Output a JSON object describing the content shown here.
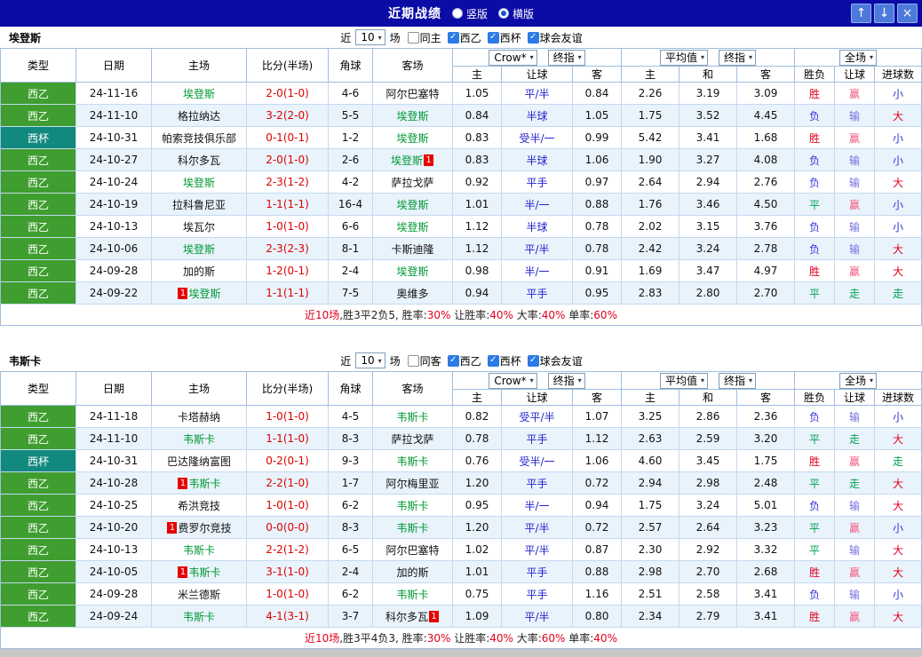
{
  "colors": {
    "red": "#e2001e",
    "blue": "#3434d6",
    "green": "#00a050",
    "pink": "#f2587e",
    "lilac": "#7070e0",
    "summary_black": "#222222"
  },
  "titlebar": {
    "title": "近期战绩",
    "layout_options": [
      {
        "label": "竖版",
        "selected": false
      },
      {
        "label": "横版",
        "selected": true
      }
    ],
    "buttons": {
      "up": "↑",
      "down": "↓",
      "close": "×"
    }
  },
  "filter_labels": {
    "near": "近",
    "count": "10",
    "games": "场"
  },
  "table_header": {
    "static_cols": [
      "类型",
      "日期",
      "主场",
      "比分(半场)",
      "角球",
      "客场"
    ],
    "group1": {
      "select1": "Crow*",
      "select2": "终指",
      "subcols": [
        "主",
        "让球",
        "客"
      ]
    },
    "group2": {
      "select1": "平均值",
      "select2": "终指",
      "subcols": [
        "主",
        "和",
        "客"
      ]
    },
    "group3": {
      "select1": "全场",
      "subcols": [
        "胜负",
        "让球",
        "进球数"
      ]
    }
  },
  "sections": [
    {
      "team": "埃登斯",
      "venue_filter": {
        "label": "同主",
        "checked": false
      },
      "league_filters": [
        {
          "label": "西乙",
          "checked": true
        },
        {
          "label": "西杯",
          "checked": true
        },
        {
          "label": "球会友谊",
          "checked": true
        }
      ],
      "rows": [
        {
          "league": "西乙",
          "style": "green",
          "date": "24-11-16",
          "home": {
            "name": "埃登斯",
            "focus": true
          },
          "score": "2-0(1-0)",
          "corner": "4-6",
          "away": {
            "name": "阿尔巴塞特",
            "focus": false
          },
          "asian": [
            "1.05",
            "平/半",
            "0.84"
          ],
          "euro": [
            "2.26",
            "3.19",
            "3.09"
          ],
          "results": [
            {
              "t": "胜",
              "c": "red"
            },
            {
              "t": "赢",
              "c": "pink"
            },
            {
              "t": "小",
              "c": "blue"
            }
          ]
        },
        {
          "league": "西乙",
          "style": "green",
          "date": "24-11-10",
          "home": {
            "name": "格拉纳达",
            "focus": false
          },
          "score": "3-2(2-0)",
          "corner": "5-5",
          "away": {
            "name": "埃登斯",
            "focus": true
          },
          "asian": [
            "0.84",
            "半球",
            "1.05"
          ],
          "euro": [
            "1.75",
            "3.52",
            "4.45"
          ],
          "results": [
            {
              "t": "负",
              "c": "blue"
            },
            {
              "t": "输",
              "c": "lilac"
            },
            {
              "t": "大",
              "c": "red"
            }
          ]
        },
        {
          "league": "西杯",
          "style": "teal",
          "date": "24-10-31",
          "home": {
            "name": "帕索竞技俱乐部",
            "focus": false
          },
          "score": "0-1(0-1)",
          "corner": "1-2",
          "away": {
            "name": "埃登斯",
            "focus": true
          },
          "asian": [
            "0.83",
            "受半/一",
            "0.99"
          ],
          "euro": [
            "5.42",
            "3.41",
            "1.68"
          ],
          "results": [
            {
              "t": "胜",
              "c": "red"
            },
            {
              "t": "赢",
              "c": "pink"
            },
            {
              "t": "小",
              "c": "blue"
            }
          ]
        },
        {
          "league": "西乙",
          "style": "green",
          "date": "24-10-27",
          "home": {
            "name": "科尔多瓦",
            "focus": false
          },
          "score": "2-0(1-0)",
          "corner": "2-6",
          "away": {
            "name": "埃登斯",
            "focus": true,
            "badge": "1",
            "badge_pos": "after"
          },
          "asian": [
            "0.83",
            "半球",
            "1.06"
          ],
          "euro": [
            "1.90",
            "3.27",
            "4.08"
          ],
          "results": [
            {
              "t": "负",
              "c": "blue"
            },
            {
              "t": "输",
              "c": "lilac"
            },
            {
              "t": "小",
              "c": "blue"
            }
          ]
        },
        {
          "league": "西乙",
          "style": "green",
          "date": "24-10-24",
          "home": {
            "name": "埃登斯",
            "focus": true
          },
          "score": "2-3(1-2)",
          "corner": "4-2",
          "away": {
            "name": "萨拉戈萨",
            "focus": false
          },
          "asian": [
            "0.92",
            "平手",
            "0.97"
          ],
          "euro": [
            "2.64",
            "2.94",
            "2.76"
          ],
          "results": [
            {
              "t": "负",
              "c": "blue"
            },
            {
              "t": "输",
              "c": "lilac"
            },
            {
              "t": "大",
              "c": "red"
            }
          ]
        },
        {
          "league": "西乙",
          "style": "green",
          "date": "24-10-19",
          "home": {
            "name": "拉科鲁尼亚",
            "focus": false
          },
          "score": "1-1(1-1)",
          "corner": "16-4",
          "away": {
            "name": "埃登斯",
            "focus": true
          },
          "asian": [
            "1.01",
            "半/一",
            "0.88"
          ],
          "euro": [
            "1.76",
            "3.46",
            "4.50"
          ],
          "results": [
            {
              "t": "平",
              "c": "green"
            },
            {
              "t": "赢",
              "c": "pink"
            },
            {
              "t": "小",
              "c": "blue"
            }
          ]
        },
        {
          "league": "西乙",
          "style": "green",
          "date": "24-10-13",
          "home": {
            "name": "埃瓦尔",
            "focus": false
          },
          "score": "1-0(1-0)",
          "corner": "6-6",
          "away": {
            "name": "埃登斯",
            "focus": true
          },
          "asian": [
            "1.12",
            "半球",
            "0.78"
          ],
          "euro": [
            "2.02",
            "3.15",
            "3.76"
          ],
          "results": [
            {
              "t": "负",
              "c": "blue"
            },
            {
              "t": "输",
              "c": "lilac"
            },
            {
              "t": "小",
              "c": "blue"
            }
          ]
        },
        {
          "league": "西乙",
          "style": "green",
          "date": "24-10-06",
          "home": {
            "name": "埃登斯",
            "focus": true
          },
          "score": "2-3(2-3)",
          "corner": "8-1",
          "away": {
            "name": "卡斯迪隆",
            "focus": false
          },
          "asian": [
            "1.12",
            "平/半",
            "0.78"
          ],
          "euro": [
            "2.42",
            "3.24",
            "2.78"
          ],
          "results": [
            {
              "t": "负",
              "c": "blue"
            },
            {
              "t": "输",
              "c": "lilac"
            },
            {
              "t": "大",
              "c": "red"
            }
          ]
        },
        {
          "league": "西乙",
          "style": "green",
          "date": "24-09-28",
          "home": {
            "name": "加的斯",
            "focus": false
          },
          "score": "1-2(0-1)",
          "corner": "2-4",
          "away": {
            "name": "埃登斯",
            "focus": true
          },
          "asian": [
            "0.98",
            "半/一",
            "0.91"
          ],
          "euro": [
            "1.69",
            "3.47",
            "4.97"
          ],
          "results": [
            {
              "t": "胜",
              "c": "red"
            },
            {
              "t": "赢",
              "c": "pink"
            },
            {
              "t": "大",
              "c": "red"
            }
          ]
        },
        {
          "league": "西乙",
          "style": "green",
          "date": "24-09-22",
          "home": {
            "name": "埃登斯",
            "focus": true,
            "badge": "1",
            "badge_pos": "before"
          },
          "score": "1-1(1-1)",
          "corner": "7-5",
          "away": {
            "name": "奥维多",
            "focus": false
          },
          "asian": [
            "0.94",
            "平手",
            "0.95"
          ],
          "euro": [
            "2.83",
            "2.80",
            "2.70"
          ],
          "results": [
            {
              "t": "平",
              "c": "green"
            },
            {
              "t": "走",
              "c": "green"
            },
            {
              "t": "走",
              "c": "green"
            }
          ]
        }
      ],
      "summary": [
        {
          "t": "近10场",
          "c": "red"
        },
        {
          "t": ",胜3平2负5, ",
          "c": "black"
        },
        {
          "t": "胜率:",
          "c": "black"
        },
        {
          "t": "30%",
          "c": "red"
        },
        {
          "t": " 让胜率:",
          "c": "black"
        },
        {
          "t": "40%",
          "c": "red"
        },
        {
          "t": " 大率:",
          "c": "black"
        },
        {
          "t": "40%",
          "c": "red"
        },
        {
          "t": " 单率:",
          "c": "black"
        },
        {
          "t": "60%",
          "c": "red"
        }
      ]
    },
    {
      "team": "韦斯卡",
      "venue_filter": {
        "label": "同客",
        "checked": false
      },
      "league_filters": [
        {
          "label": "西乙",
          "checked": true
        },
        {
          "label": "西杯",
          "checked": true
        },
        {
          "label": "球会友谊",
          "checked": true
        }
      ],
      "rows": [
        {
          "league": "西乙",
          "style": "green",
          "date": "24-11-18",
          "home": {
            "name": "卡塔赫纳",
            "focus": false
          },
          "score": "1-0(1-0)",
          "corner": "4-5",
          "away": {
            "name": "韦斯卡",
            "focus": true
          },
          "asian": [
            "0.82",
            "受平/半",
            "1.07"
          ],
          "euro": [
            "3.25",
            "2.86",
            "2.36"
          ],
          "results": [
            {
              "t": "负",
              "c": "blue"
            },
            {
              "t": "输",
              "c": "lilac"
            },
            {
              "t": "小",
              "c": "blue"
            }
          ]
        },
        {
          "league": "西乙",
          "style": "green",
          "date": "24-11-10",
          "home": {
            "name": "韦斯卡",
            "focus": true
          },
          "score": "1-1(1-0)",
          "corner": "8-3",
          "away": {
            "name": "萨拉戈萨",
            "focus": false
          },
          "asian": [
            "0.78",
            "平手",
            "1.12"
          ],
          "euro": [
            "2.63",
            "2.59",
            "3.20"
          ],
          "results": [
            {
              "t": "平",
              "c": "green"
            },
            {
              "t": "走",
              "c": "green"
            },
            {
              "t": "大",
              "c": "red"
            }
          ]
        },
        {
          "league": "西杯",
          "style": "teal",
          "date": "24-10-31",
          "home": {
            "name": "巴达隆纳富图",
            "focus": false
          },
          "score": "0-2(0-1)",
          "corner": "9-3",
          "away": {
            "name": "韦斯卡",
            "focus": true
          },
          "asian": [
            "0.76",
            "受半/一",
            "1.06"
          ],
          "euro": [
            "4.60",
            "3.45",
            "1.75"
          ],
          "results": [
            {
              "t": "胜",
              "c": "red"
            },
            {
              "t": "赢",
              "c": "pink"
            },
            {
              "t": "走",
              "c": "green"
            }
          ]
        },
        {
          "league": "西乙",
          "style": "green",
          "date": "24-10-28",
          "home": {
            "name": "韦斯卡",
            "focus": true,
            "badge": "1",
            "badge_pos": "before"
          },
          "score": "2-2(1-0)",
          "corner": "1-7",
          "away": {
            "name": "阿尔梅里亚",
            "focus": false
          },
          "asian": [
            "1.20",
            "平手",
            "0.72"
          ],
          "euro": [
            "2.94",
            "2.98",
            "2.48"
          ],
          "results": [
            {
              "t": "平",
              "c": "green"
            },
            {
              "t": "走",
              "c": "green"
            },
            {
              "t": "大",
              "c": "red"
            }
          ]
        },
        {
          "league": "西乙",
          "style": "green",
          "date": "24-10-25",
          "home": {
            "name": "希洪竞技",
            "focus": false
          },
          "score": "1-0(1-0)",
          "corner": "6-2",
          "away": {
            "name": "韦斯卡",
            "focus": true
          },
          "asian": [
            "0.95",
            "半/一",
            "0.94"
          ],
          "euro": [
            "1.75",
            "3.24",
            "5.01"
          ],
          "results": [
            {
              "t": "负",
              "c": "blue"
            },
            {
              "t": "输",
              "c": "lilac"
            },
            {
              "t": "大",
              "c": "red"
            }
          ]
        },
        {
          "league": "西乙",
          "style": "green",
          "date": "24-10-20",
          "home": {
            "name": "费罗尔竞技",
            "focus": false,
            "badge": "1",
            "badge_pos": "before"
          },
          "score": "0-0(0-0)",
          "corner": "8-3",
          "away": {
            "name": "韦斯卡",
            "focus": true
          },
          "asian": [
            "1.20",
            "平/半",
            "0.72"
          ],
          "euro": [
            "2.57",
            "2.64",
            "3.23"
          ],
          "results": [
            {
              "t": "平",
              "c": "green"
            },
            {
              "t": "赢",
              "c": "pink"
            },
            {
              "t": "小",
              "c": "blue"
            }
          ]
        },
        {
          "league": "西乙",
          "style": "green",
          "date": "24-10-13",
          "home": {
            "name": "韦斯卡",
            "focus": true
          },
          "score": "2-2(1-2)",
          "corner": "6-5",
          "away": {
            "name": "阿尔巴塞特",
            "focus": false
          },
          "asian": [
            "1.02",
            "平/半",
            "0.87"
          ],
          "euro": [
            "2.30",
            "2.92",
            "3.32"
          ],
          "results": [
            {
              "t": "平",
              "c": "green"
            },
            {
              "t": "输",
              "c": "lilac"
            },
            {
              "t": "大",
              "c": "red"
            }
          ]
        },
        {
          "league": "西乙",
          "style": "green",
          "date": "24-10-05",
          "home": {
            "name": "韦斯卡",
            "focus": true,
            "badge": "1",
            "badge_pos": "before"
          },
          "score": "3-1(1-0)",
          "corner": "2-4",
          "away": {
            "name": "加的斯",
            "focus": false
          },
          "asian": [
            "1.01",
            "平手",
            "0.88"
          ],
          "euro": [
            "2.98",
            "2.70",
            "2.68"
          ],
          "results": [
            {
              "t": "胜",
              "c": "red"
            },
            {
              "t": "赢",
              "c": "pink"
            },
            {
              "t": "大",
              "c": "red"
            }
          ]
        },
        {
          "league": "西乙",
          "style": "green",
          "date": "24-09-28",
          "home": {
            "name": "米兰德斯",
            "focus": false
          },
          "score": "1-0(1-0)",
          "corner": "6-2",
          "away": {
            "name": "韦斯卡",
            "focus": true
          },
          "asian": [
            "0.75",
            "平手",
            "1.16"
          ],
          "euro": [
            "2.51",
            "2.58",
            "3.41"
          ],
          "results": [
            {
              "t": "负",
              "c": "blue"
            },
            {
              "t": "输",
              "c": "lilac"
            },
            {
              "t": "小",
              "c": "blue"
            }
          ]
        },
        {
          "league": "西乙",
          "style": "green",
          "date": "24-09-24",
          "home": {
            "name": "韦斯卡",
            "focus": true
          },
          "score": "4-1(3-1)",
          "corner": "3-7",
          "away": {
            "name": "科尔多瓦",
            "focus": false,
            "badge": "1",
            "badge_pos": "after"
          },
          "asian": [
            "1.09",
            "平/半",
            "0.80"
          ],
          "euro": [
            "2.34",
            "2.79",
            "3.41"
          ],
          "results": [
            {
              "t": "胜",
              "c": "red"
            },
            {
              "t": "赢",
              "c": "pink"
            },
            {
              "t": "大",
              "c": "red"
            }
          ]
        }
      ],
      "summary": [
        {
          "t": "近10场",
          "c": "red"
        },
        {
          "t": ",胜3平4负3, ",
          "c": "black"
        },
        {
          "t": "胜率:",
          "c": "black"
        },
        {
          "t": "30%",
          "c": "red"
        },
        {
          "t": " 让胜率:",
          "c": "black"
        },
        {
          "t": "40%",
          "c": "red"
        },
        {
          "t": " 大率:",
          "c": "black"
        },
        {
          "t": "60%",
          "c": "red"
        },
        {
          "t": " 单率:",
          "c": "black"
        },
        {
          "t": "40%",
          "c": "red"
        }
      ]
    }
  ]
}
